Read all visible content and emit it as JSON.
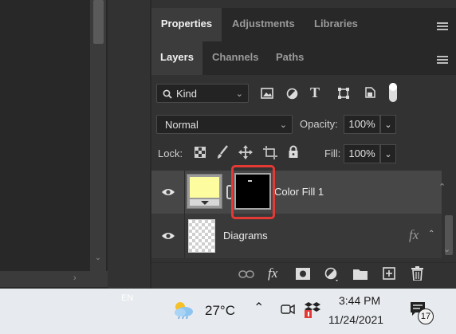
{
  "top_tabs": [
    "Properties",
    "Adjustments",
    "Libraries"
  ],
  "layer_tabs": [
    "Layers",
    "Channels",
    "Paths"
  ],
  "filter": {
    "kind_label": "Kind"
  },
  "blend": {
    "mode": "Normal",
    "opacity_label": "Opacity:",
    "opacity_value": "100%"
  },
  "lock": {
    "label": "Lock:",
    "fill_label": "Fill:",
    "fill_value": "100%"
  },
  "layers": [
    {
      "name": "Color Fill 1",
      "selected": true,
      "swatch_color": "#fdfd9f"
    },
    {
      "name": "Diagrams",
      "fx": "fx"
    }
  ],
  "bottom_bar": {
    "fx_label": "fx"
  },
  "taskbar": {
    "language": "EN",
    "temperature": "27°C",
    "time": "3:44 PM",
    "date": "11/24/2021",
    "notification_count": "17"
  },
  "colors": {
    "highlight": "#e53935",
    "panel": "#323232"
  }
}
